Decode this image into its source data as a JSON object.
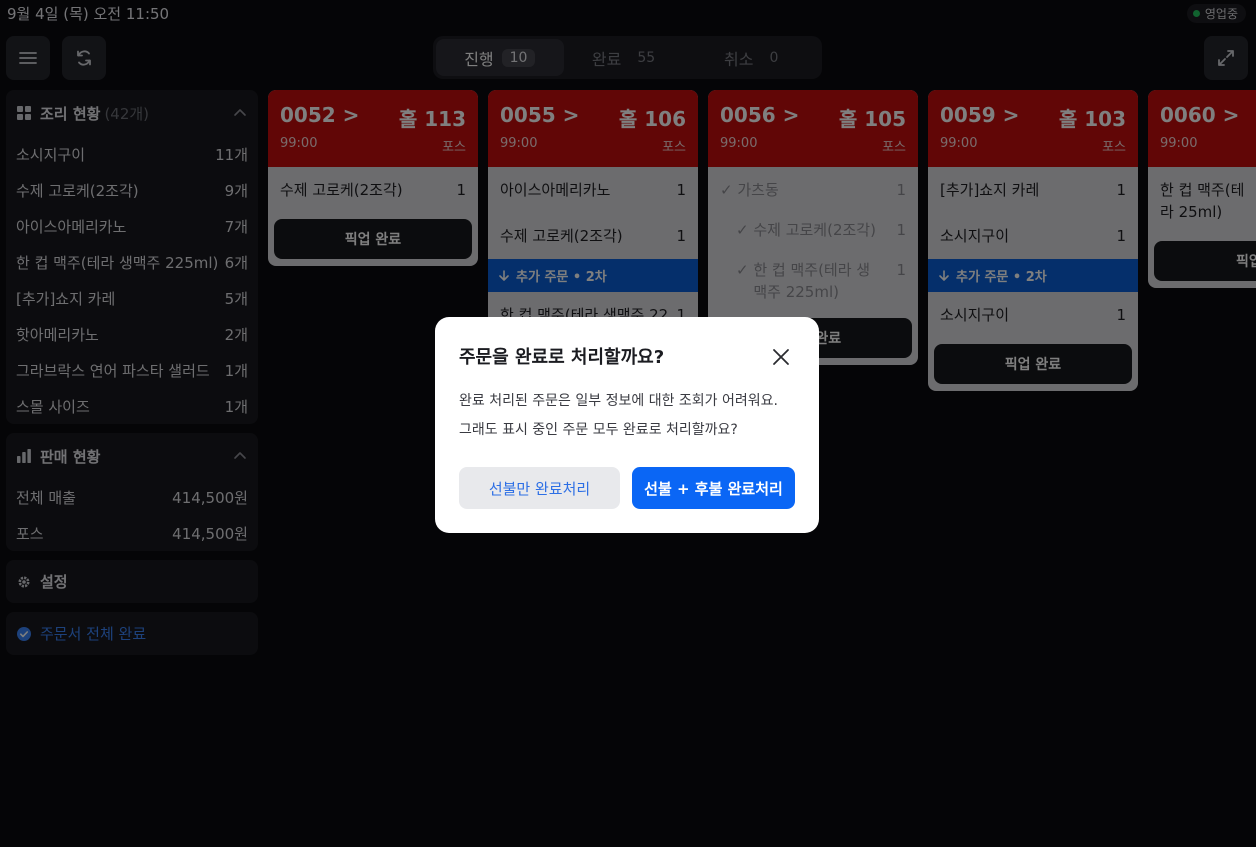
{
  "status": {
    "time": "9월 4일 (목) 오전 11:50",
    "open_label": "영업중",
    "open_color": "#22c55e"
  },
  "tabs": [
    {
      "label": "진행",
      "count": "10"
    },
    {
      "label": "완료",
      "count": "55"
    },
    {
      "label": "취소",
      "count": "0"
    }
  ],
  "cooking": {
    "title": "조리 현황",
    "count": "(42개)",
    "items": [
      {
        "name": "소시지구이",
        "qty": "11개"
      },
      {
        "name": "수제 고로케(2조각)",
        "qty": "9개"
      },
      {
        "name": "아이스아메리카노",
        "qty": "7개"
      },
      {
        "name": "한 컵 맥주(테라 생맥주 225ml)",
        "qty": "6개"
      },
      {
        "name": "[추가]쇼지 카레",
        "qty": "5개"
      },
      {
        "name": "핫아메리카노",
        "qty": "2개"
      },
      {
        "name": "그라브락스 연어 파스타 샐러드",
        "qty": "1개"
      },
      {
        "name": "스몰 사이즈",
        "qty": "1개"
      }
    ]
  },
  "sales": {
    "title": "판매 현황",
    "rows": [
      {
        "label": "전체 매출",
        "value": "414,500원"
      },
      {
        "label": "포스",
        "value": "414,500원"
      }
    ]
  },
  "settings_label": "설정",
  "complete_all_label": "주문서 전체 완료",
  "orders": [
    {
      "no": "0052 >",
      "table": "홀 113",
      "time": "99:00",
      "source": "포스",
      "items": [
        {
          "name": "수제 고로케(2조각)",
          "qty": "1"
        }
      ],
      "pickup": "픽업 완료"
    },
    {
      "no": "0055 >",
      "table": "홀 106",
      "time": "99:00",
      "source": "포스",
      "items": [
        {
          "name": "아이스아메리카노",
          "qty": "1"
        },
        {
          "name": "수제 고로케(2조각)",
          "qty": "1"
        }
      ],
      "addon": "추가 주문 • 2차",
      "addon_items": [
        {
          "name": "한 컵 맥주(테라 생맥주 22",
          "qty": "1"
        }
      ]
    },
    {
      "no": "0056 >",
      "table": "홀 105",
      "time": "99:00",
      "source": "포스",
      "items": [
        {
          "name": "가츠동",
          "qty": "1"
        },
        {
          "name": "수제 고로케(2조각)",
          "qty": "1"
        },
        {
          "name": "한 컵 맥주(테라 생맥주 225ml)",
          "qty": "1"
        }
      ],
      "pickup": "픽업 완료"
    },
    {
      "no": "0059 >",
      "table": "홀 103",
      "time": "99:00",
      "source": "포스",
      "items": [
        {
          "name": "[추가]쇼지 카레",
          "qty": "1"
        },
        {
          "name": "소시지구이",
          "qty": "1"
        }
      ],
      "addon": "추가 주문 • 2차",
      "addon_items": [
        {
          "name": "소시지구이",
          "qty": "1"
        }
      ],
      "pickup": "픽업 완료"
    },
    {
      "no": "0060 >",
      "time": "99:00",
      "items": [
        {
          "name": "한 컵 맥주(테라 25ml)",
          "qty": ""
        }
      ],
      "pickup": "픽업"
    }
  ],
  "modal": {
    "title": "주문을 완료로 처리할까요?",
    "body_line1": "완료 처리된 주문은 일부 정보에 대한 조회가 어려워요.",
    "body_line2": "그래도 표시 중인 주문 모두 완료로 처리할까요?",
    "secondary": "선불만 완료처리",
    "primary": "선불 + 후불 완료처리"
  }
}
